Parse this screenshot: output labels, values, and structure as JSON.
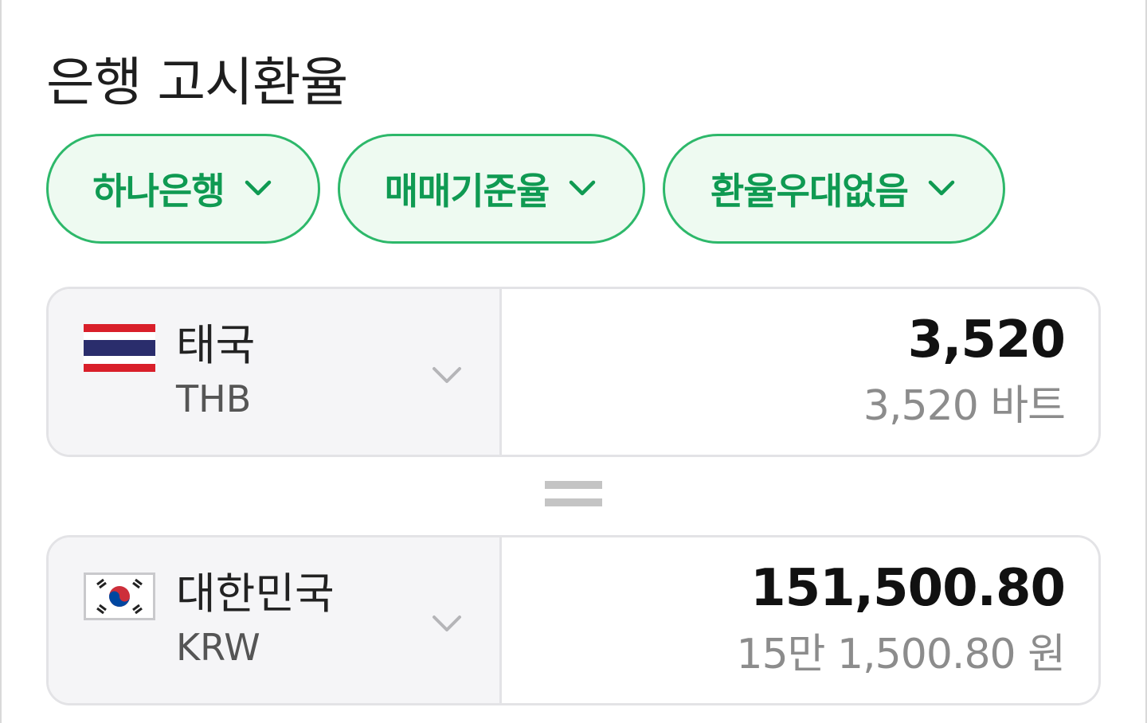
{
  "page": {
    "title": "은행 고시환율"
  },
  "filters": [
    {
      "label": "하나은행",
      "icon": "chevron-down-icon"
    },
    {
      "label": "매매기준율",
      "icon": "chevron-down-icon"
    },
    {
      "label": "환율우대없음",
      "icon": "chevron-down-icon"
    }
  ],
  "from_currency": {
    "country": "태국",
    "code": "THB",
    "flag_icon": "thailand-flag-icon",
    "amount": "3,520",
    "amount_text": "3,520 바트"
  },
  "to_currency": {
    "country": "대한민국",
    "code": "KRW",
    "flag_icon": "south-korea-flag-icon",
    "amount": "151,500.80",
    "amount_text": "15만 1,500.80 원"
  },
  "colors": {
    "accent_green": "#0f9a52",
    "chip_border": "#2db86a",
    "chip_background": "#eefaf1",
    "card_border": "#e3e3e6",
    "selector_background": "#f5f5f7",
    "muted_text": "#8c8c8c"
  }
}
